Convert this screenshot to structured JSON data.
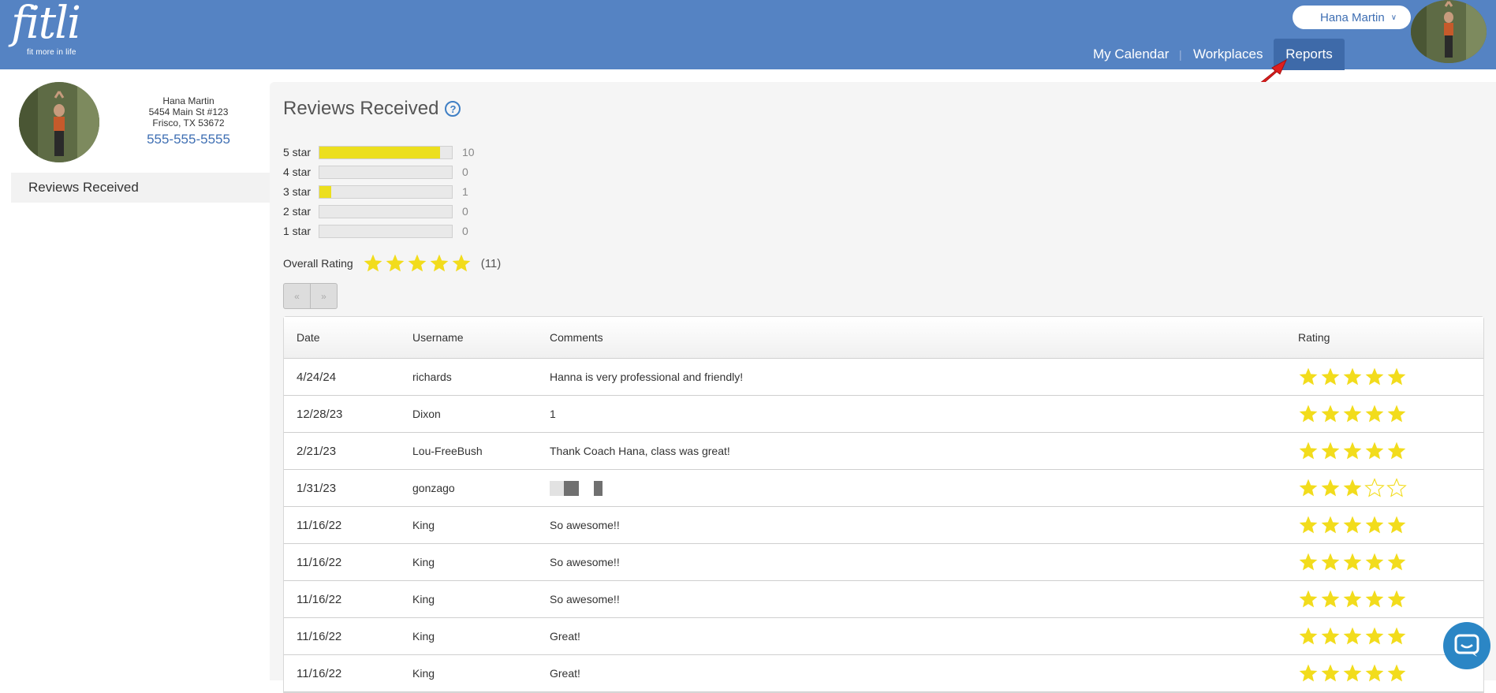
{
  "header": {
    "logo_text": "fitli",
    "logo_tagline": "fit more in life",
    "user_name": "Hana Martin",
    "nav": [
      "My Calendar",
      "Workplaces",
      "Reports"
    ],
    "brand_color": "#5583c3"
  },
  "profile": {
    "name": "Hana Martin",
    "address1": "5454 Main St #123",
    "address2": "Frisco, TX 53672",
    "phone": "555-555-5555"
  },
  "sidebar": {
    "items": [
      "Reviews Received"
    ]
  },
  "reviews": {
    "title": "Reviews Received",
    "help_icon": "?",
    "distribution": [
      {
        "label": "5 star",
        "count": "10",
        "fraction": 0.91
      },
      {
        "label": "4 star",
        "count": "0",
        "fraction": 0
      },
      {
        "label": "3 star",
        "count": "1",
        "fraction": 0.09
      },
      {
        "label": "2 star",
        "count": "0",
        "fraction": 0
      },
      {
        "label": "1 star",
        "count": "0",
        "fraction": 0
      }
    ],
    "overall_label": "Overall Rating",
    "overall_stars": 5,
    "overall_count": "(11)",
    "pager": {
      "prev": "«",
      "next": "»"
    },
    "table": {
      "columns": [
        "Date",
        "Username",
        "Comments",
        "Rating"
      ],
      "rows": [
        {
          "date": "4/24/24",
          "username": "richards",
          "comment": "Hanna is very professional and friendly!",
          "rating": 5
        },
        {
          "date": "12/28/23",
          "username": "Dixon",
          "comment": "1",
          "rating": 5
        },
        {
          "date": "2/21/23",
          "username": "Lou-FreeBush",
          "comment": "Thank Coach Hana, class was great!",
          "rating": 5
        },
        {
          "date": "1/31/23",
          "username": "gonzago",
          "comment": "",
          "comment_redacted": true,
          "rating": 3
        },
        {
          "date": "11/16/22",
          "username": "King",
          "comment": "So awesome!!",
          "rating": 5
        },
        {
          "date": "11/16/22",
          "username": "King",
          "comment": "So awesome!!",
          "rating": 5
        },
        {
          "date": "11/16/22",
          "username": "King",
          "comment": "So awesome!!",
          "rating": 5
        },
        {
          "date": "11/16/22",
          "username": "King",
          "comment": "Great!",
          "rating": 5
        },
        {
          "date": "11/16/22",
          "username": "King",
          "comment": "Great!",
          "rating": 5
        }
      ]
    },
    "star_color": "#f2dc1c"
  },
  "icons": [
    "chevron-down-icon",
    "help-icon",
    "star-icon",
    "chat-icon",
    "avatar"
  ]
}
